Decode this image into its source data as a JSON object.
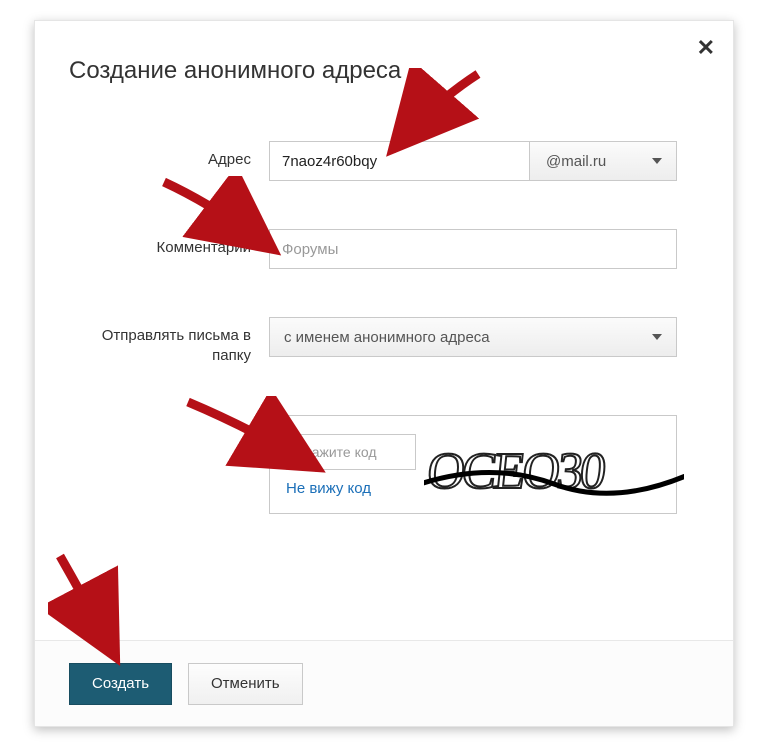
{
  "title": "Создание анонимного адреса",
  "close_symbol": "✕",
  "labels": {
    "address": "Адрес",
    "comment": "Комментарий",
    "folder": "Отправлять письма в папку"
  },
  "address": {
    "value": "7naoz4r60bqy",
    "domain": "@mail.ru"
  },
  "comment": {
    "placeholder": "Форумы"
  },
  "folder": {
    "selected": "с именем анонимного адреса"
  },
  "captcha": {
    "placeholder": "Укажите код",
    "cant_see_link": "Не вижу код",
    "image_text": "OCEO30"
  },
  "buttons": {
    "create": "Создать",
    "cancel": "Отменить"
  }
}
